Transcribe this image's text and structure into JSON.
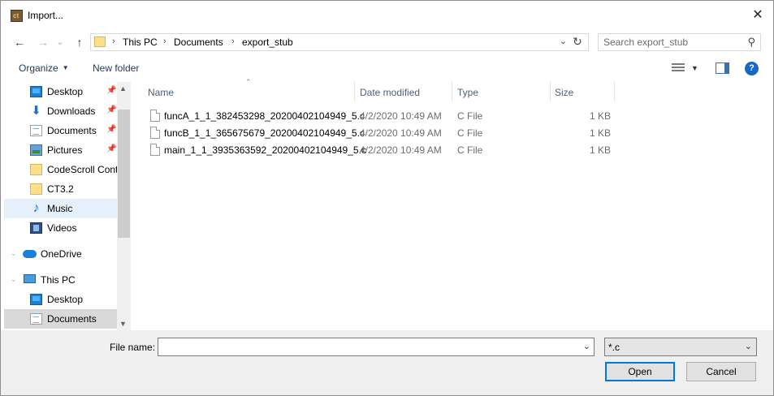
{
  "window": {
    "title": "Import...",
    "close_glyph": "✕"
  },
  "nav": {
    "back_glyph": "←",
    "forward_glyph": "→",
    "recent_glyph": "⌄",
    "up_glyph": "↑",
    "breadcrumbs": [
      "This PC",
      "Documents",
      "export_stub"
    ],
    "breadcrumb_sep": "›",
    "dropdown_glyph": "⌄",
    "refresh_glyph": "↻",
    "search_placeholder": "Search export_stub",
    "search_glyph": "⚲"
  },
  "toolbar": {
    "organize": "Organize",
    "organize_arrow": "▼",
    "new_folder": "New folder",
    "view_dd_glyph": "▼",
    "help_glyph": "?"
  },
  "sidebar": {
    "items": [
      {
        "label": "Desktop",
        "icon": "desktop-icon",
        "pinned": true
      },
      {
        "label": "Downloads",
        "icon": "downloads-icon",
        "pinned": true
      },
      {
        "label": "Documents",
        "icon": "documents-icon",
        "pinned": true
      },
      {
        "label": "Pictures",
        "icon": "pictures-icon",
        "pinned": true
      },
      {
        "label": "CodeScroll Cont",
        "icon": "folder-icon"
      },
      {
        "label": "CT3.2",
        "icon": "folder-icon"
      },
      {
        "label": "Music",
        "icon": "music-icon",
        "selected": true
      },
      {
        "label": "Videos",
        "icon": "videos-icon"
      },
      {
        "label": "OneDrive",
        "icon": "onedrive-icon"
      },
      {
        "label": "This PC",
        "icon": "this-pc-icon"
      },
      {
        "label": "Desktop",
        "icon": "desktop-icon"
      },
      {
        "label": "Documents",
        "icon": "documents-icon",
        "pressed": true
      }
    ],
    "pin_glyph": "📌",
    "expand_glyph": "⌄",
    "scroll_up_glyph": "▲",
    "scroll_down_glyph": "▼"
  },
  "filelist": {
    "columns": [
      "Name",
      "Date modified",
      "Type",
      "Size"
    ],
    "sort_glyph": "⌃",
    "files": [
      {
        "name": "funcA_1_1_382453298_20200402104949_5.c",
        "date": "4/2/2020 10:49 AM",
        "type": "C File",
        "size": "1 KB"
      },
      {
        "name": "funcB_1_1_365675679_20200402104949_5.c",
        "date": "4/2/2020 10:49 AM",
        "type": "C File",
        "size": "1 KB"
      },
      {
        "name": "main_1_1_3935363592_20200402104949_5.c",
        "date": "4/2/2020 10:49 AM",
        "type": "C File",
        "size": "1 KB"
      }
    ]
  },
  "bottom": {
    "filename_label": "File name:",
    "filename_value": "",
    "dropdown_glyph": "⌄",
    "filter_value": "*.c",
    "open_label": "Open",
    "cancel_label": "Cancel"
  },
  "colors": {
    "accent": "#0078d7",
    "selected_bg": "#e5f0fb",
    "link": "#1e395b"
  }
}
